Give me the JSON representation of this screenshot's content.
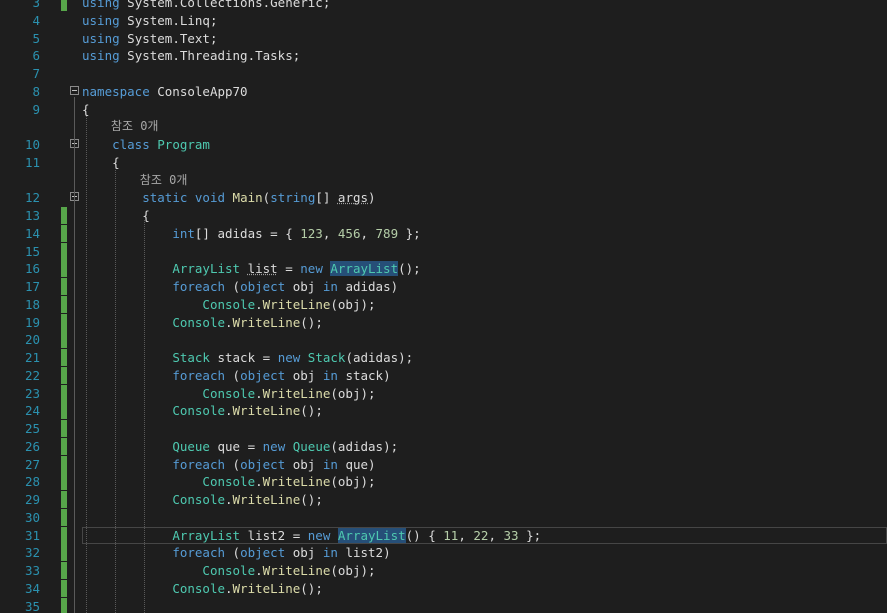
{
  "editor": {
    "lines": [
      {
        "n": "3",
        "tokens": [
          {
            "t": "using",
            "c": "kw"
          },
          {
            "t": " System.Collections.Generic;",
            "c": "pn"
          }
        ],
        "mark": true
      },
      {
        "n": "4",
        "tokens": [
          {
            "t": "using",
            "c": "kw"
          },
          {
            "t": " System.Linq;",
            "c": "pn"
          }
        ],
        "mark": false
      },
      {
        "n": "5",
        "tokens": [
          {
            "t": "using",
            "c": "kw"
          },
          {
            "t": " System.Text;",
            "c": "pn"
          }
        ],
        "mark": false
      },
      {
        "n": "6",
        "tokens": [
          {
            "t": "using",
            "c": "kw"
          },
          {
            "t": " System.Threading.Tasks;",
            "c": "pn"
          }
        ],
        "mark": false
      },
      {
        "n": "7",
        "tokens": [],
        "mark": false
      },
      {
        "n": "8",
        "tokens": [
          {
            "t": "namespace",
            "c": "kw"
          },
          {
            "t": " ConsoleApp70",
            "c": "id"
          }
        ],
        "mark": false,
        "fold": true
      },
      {
        "n": "9",
        "tokens": [
          {
            "t": "{",
            "c": "pn"
          }
        ],
        "mark": false
      },
      {
        "lens": "참조 0개",
        "indent": "    "
      },
      {
        "n": "10",
        "tokens": [
          {
            "t": "    "
          },
          {
            "t": "class",
            "c": "kw"
          },
          {
            "t": " "
          },
          {
            "t": "Program",
            "c": "ty"
          }
        ],
        "mark": false,
        "fold": true
      },
      {
        "n": "11",
        "tokens": [
          {
            "t": "    {",
            "c": "pn"
          }
        ],
        "mark": false
      },
      {
        "lens": "참조 0개",
        "indent": "        "
      },
      {
        "n": "12",
        "tokens": [
          {
            "t": "        "
          },
          {
            "t": "static",
            "c": "kw"
          },
          {
            "t": " "
          },
          {
            "t": "void",
            "c": "kw"
          },
          {
            "t": " "
          },
          {
            "t": "Main",
            "c": "fn"
          },
          {
            "t": "(",
            "c": "pn"
          },
          {
            "t": "string",
            "c": "kw"
          },
          {
            "t": "[] ",
            "c": "pn"
          },
          {
            "t": "args",
            "c": "id",
            "sq": true
          },
          {
            "t": ")",
            "c": "pn"
          }
        ],
        "mark": false,
        "fold": true
      },
      {
        "n": "13",
        "tokens": [
          {
            "t": "        {",
            "c": "pn"
          }
        ],
        "mark": true
      },
      {
        "n": "14",
        "tokens": [
          {
            "t": "            "
          },
          {
            "t": "int",
            "c": "kw"
          },
          {
            "t": "[] adidas = { ",
            "c": "pn"
          },
          {
            "t": "123",
            "c": "nm"
          },
          {
            "t": ", ",
            "c": "pn"
          },
          {
            "t": "456",
            "c": "nm"
          },
          {
            "t": ", ",
            "c": "pn"
          },
          {
            "t": "789",
            "c": "nm"
          },
          {
            "t": " };",
            "c": "pn"
          }
        ],
        "mark": true
      },
      {
        "n": "15",
        "tokens": [],
        "mark": true
      },
      {
        "n": "16",
        "tokens": [
          {
            "t": "            "
          },
          {
            "t": "ArrayList",
            "c": "ty"
          },
          {
            "t": " "
          },
          {
            "t": "list",
            "c": "id",
            "sq": true
          },
          {
            "t": " = ",
            "c": "pn"
          },
          {
            "t": "new",
            "c": "kw"
          },
          {
            "t": " "
          },
          {
            "t": "ArrayList",
            "c": "ty",
            "hl": true
          },
          {
            "t": "();",
            "c": "pn"
          }
        ],
        "mark": true
      },
      {
        "n": "17",
        "tokens": [
          {
            "t": "            "
          },
          {
            "t": "foreach",
            "c": "kw"
          },
          {
            "t": " (",
            "c": "pn"
          },
          {
            "t": "object",
            "c": "kw"
          },
          {
            "t": " obj ",
            "c": "id"
          },
          {
            "t": "in",
            "c": "kw"
          },
          {
            "t": " adidas)",
            "c": "pn"
          }
        ],
        "mark": true
      },
      {
        "n": "18",
        "tokens": [
          {
            "t": "                "
          },
          {
            "t": "Console",
            "c": "ty"
          },
          {
            "t": ".",
            "c": "pn"
          },
          {
            "t": "WriteLine",
            "c": "fn"
          },
          {
            "t": "(obj);",
            "c": "pn"
          }
        ],
        "mark": true
      },
      {
        "n": "19",
        "tokens": [
          {
            "t": "            "
          },
          {
            "t": "Console",
            "c": "ty"
          },
          {
            "t": ".",
            "c": "pn"
          },
          {
            "t": "WriteLine",
            "c": "fn"
          },
          {
            "t": "();",
            "c": "pn"
          }
        ],
        "mark": true
      },
      {
        "n": "20",
        "tokens": [],
        "mark": true
      },
      {
        "n": "21",
        "tokens": [
          {
            "t": "            "
          },
          {
            "t": "Stack",
            "c": "ty"
          },
          {
            "t": " stack = ",
            "c": "pn"
          },
          {
            "t": "new",
            "c": "kw"
          },
          {
            "t": " "
          },
          {
            "t": "Stack",
            "c": "ty"
          },
          {
            "t": "(adidas);",
            "c": "pn"
          }
        ],
        "mark": true
      },
      {
        "n": "22",
        "tokens": [
          {
            "t": "            "
          },
          {
            "t": "foreach",
            "c": "kw"
          },
          {
            "t": " (",
            "c": "pn"
          },
          {
            "t": "object",
            "c": "kw"
          },
          {
            "t": " obj ",
            "c": "id"
          },
          {
            "t": "in",
            "c": "kw"
          },
          {
            "t": " stack)",
            "c": "pn"
          }
        ],
        "mark": true
      },
      {
        "n": "23",
        "tokens": [
          {
            "t": "                "
          },
          {
            "t": "Console",
            "c": "ty"
          },
          {
            "t": ".",
            "c": "pn"
          },
          {
            "t": "WriteLine",
            "c": "fn"
          },
          {
            "t": "(obj);",
            "c": "pn"
          }
        ],
        "mark": true
      },
      {
        "n": "24",
        "tokens": [
          {
            "t": "            "
          },
          {
            "t": "Console",
            "c": "ty"
          },
          {
            "t": ".",
            "c": "pn"
          },
          {
            "t": "WriteLine",
            "c": "fn"
          },
          {
            "t": "();",
            "c": "pn"
          }
        ],
        "mark": true
      },
      {
        "n": "25",
        "tokens": [],
        "mark": true
      },
      {
        "n": "26",
        "tokens": [
          {
            "t": "            "
          },
          {
            "t": "Queue",
            "c": "ty"
          },
          {
            "t": " que = ",
            "c": "pn"
          },
          {
            "t": "new",
            "c": "kw"
          },
          {
            "t": " "
          },
          {
            "t": "Queue",
            "c": "ty"
          },
          {
            "t": "(adidas);",
            "c": "pn"
          }
        ],
        "mark": true
      },
      {
        "n": "27",
        "tokens": [
          {
            "t": "            "
          },
          {
            "t": "foreach",
            "c": "kw"
          },
          {
            "t": " (",
            "c": "pn"
          },
          {
            "t": "object",
            "c": "kw"
          },
          {
            "t": " obj ",
            "c": "id"
          },
          {
            "t": "in",
            "c": "kw"
          },
          {
            "t": " que)",
            "c": "pn"
          }
        ],
        "mark": true
      },
      {
        "n": "28",
        "tokens": [
          {
            "t": "                "
          },
          {
            "t": "Console",
            "c": "ty"
          },
          {
            "t": ".",
            "c": "pn"
          },
          {
            "t": "WriteLine",
            "c": "fn"
          },
          {
            "t": "(obj);",
            "c": "pn"
          }
        ],
        "mark": true
      },
      {
        "n": "29",
        "tokens": [
          {
            "t": "            "
          },
          {
            "t": "Console",
            "c": "ty"
          },
          {
            "t": ".",
            "c": "pn"
          },
          {
            "t": "WriteLine",
            "c": "fn"
          },
          {
            "t": "();",
            "c": "pn"
          }
        ],
        "mark": true
      },
      {
        "n": "30",
        "tokens": [],
        "mark": true
      },
      {
        "n": "31",
        "tokens": [
          {
            "t": "            "
          },
          {
            "t": "ArrayList",
            "c": "ty"
          },
          {
            "t": " list2 = ",
            "c": "pn"
          },
          {
            "t": "new",
            "c": "kw"
          },
          {
            "t": " "
          },
          {
            "t": "ArrayList",
            "c": "ty",
            "hl": true
          },
          {
            "t": "() { ",
            "c": "pn"
          },
          {
            "t": "11",
            "c": "nm"
          },
          {
            "t": ", ",
            "c": "pn"
          },
          {
            "t": "22",
            "c": "nm"
          },
          {
            "t": ", ",
            "c": "pn"
          },
          {
            "t": "33",
            "c": "nm"
          },
          {
            "t": " };",
            "c": "pn"
          }
        ],
        "mark": true,
        "current": true
      },
      {
        "n": "32",
        "tokens": [
          {
            "t": "            "
          },
          {
            "t": "foreach",
            "c": "kw"
          },
          {
            "t": " (",
            "c": "pn"
          },
          {
            "t": "object",
            "c": "kw"
          },
          {
            "t": " obj ",
            "c": "id"
          },
          {
            "t": "in",
            "c": "kw"
          },
          {
            "t": " list2)",
            "c": "pn"
          }
        ],
        "mark": true
      },
      {
        "n": "33",
        "tokens": [
          {
            "t": "                "
          },
          {
            "t": "Console",
            "c": "ty"
          },
          {
            "t": ".",
            "c": "pn"
          },
          {
            "t": "WriteLine",
            "c": "fn"
          },
          {
            "t": "(obj);",
            "c": "pn"
          }
        ],
        "mark": true
      },
      {
        "n": "34",
        "tokens": [
          {
            "t": "            "
          },
          {
            "t": "Console",
            "c": "ty"
          },
          {
            "t": ".",
            "c": "pn"
          },
          {
            "t": "WriteLine",
            "c": "fn"
          },
          {
            "t": "();",
            "c": "pn"
          }
        ],
        "mark": true
      },
      {
        "n": "35",
        "tokens": [],
        "mark": true
      }
    ]
  },
  "colors": {
    "background": "#1e1e1e",
    "line_number": "#2b91af",
    "keyword": "#569cd6",
    "type": "#4ec9b0",
    "method": "#dcdcaa",
    "number": "#b5cea8",
    "change_mark": "#57a64a"
  }
}
